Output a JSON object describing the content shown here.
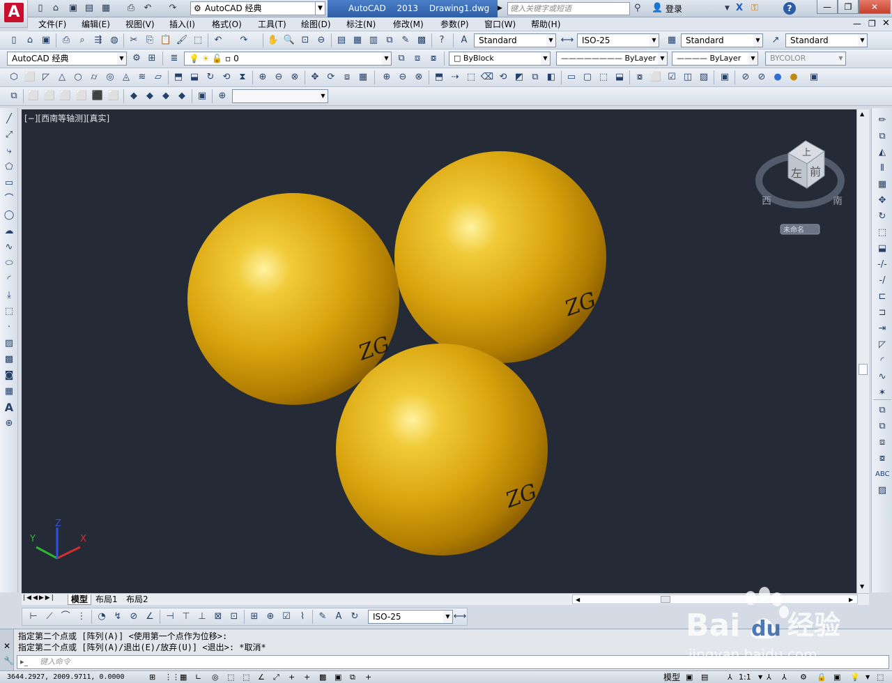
{
  "title_bar": {
    "app_button_letter": "A",
    "workspace": "AutoCAD 经典",
    "app_name": "AutoCAD 2013",
    "file_name": "Drawing1.dwg",
    "search_placeholder": "键入关键字或短语",
    "login": "登录",
    "help": "?"
  },
  "menu": [
    "文件(F)",
    "编辑(E)",
    "视图(V)",
    "插入(I)",
    "格式(O)",
    "工具(T)",
    "绘图(D)",
    "标注(N)",
    "修改(M)",
    "参数(P)",
    "窗口(W)",
    "帮助(H)"
  ],
  "styles_toolbar": {
    "text_style": "Standard",
    "dim_style": "ISO-25",
    "table_style": "Standard",
    "mleader_style": "Standard"
  },
  "layers_toolbar": {
    "workspace": "AutoCAD 经典",
    "layer": "0",
    "color": "ByBlock",
    "linetype": "ByLayer",
    "lineweight": "ByLayer",
    "plotstyle": "BYCOLOR"
  },
  "viewport": {
    "label": "[−][西南等轴测][真实]",
    "viewcube": {
      "top": "上",
      "left": "左",
      "front": "前",
      "west": "西",
      "south": "南",
      "unnamed": "未命名"
    },
    "spheres_text": [
      "ZG",
      "ZG",
      "ZG"
    ],
    "ucs": {
      "x": "X",
      "y": "Y",
      "z": "Z"
    },
    "colors": {
      "bg": "#252b36",
      "sphere": "#d9a50e",
      "sphere_highlight": "#fff3a0",
      "sphere_shadow": "#8a5d00"
    }
  },
  "layout_tabs": [
    "模型",
    "布局1",
    "布局2"
  ],
  "dim_toolbar": {
    "dim_style": "ISO-25"
  },
  "command": {
    "line1": "指定第二个点或 [阵列(A)] <使用第一个点作为位移>:",
    "line2": "指定第二个点或 [阵列(A)/退出(E)/放弃(U)] <退出>: *取消*",
    "placeholder": "键入命令"
  },
  "status": {
    "coords": "3644.2927, 2009.9711, 0.0000",
    "model": "模型",
    "scale": "1:1"
  },
  "watermark": {
    "brand": "Bai",
    "brand2": "du",
    "site_cn": "经验",
    "url": "jingyan.baidu.com"
  }
}
